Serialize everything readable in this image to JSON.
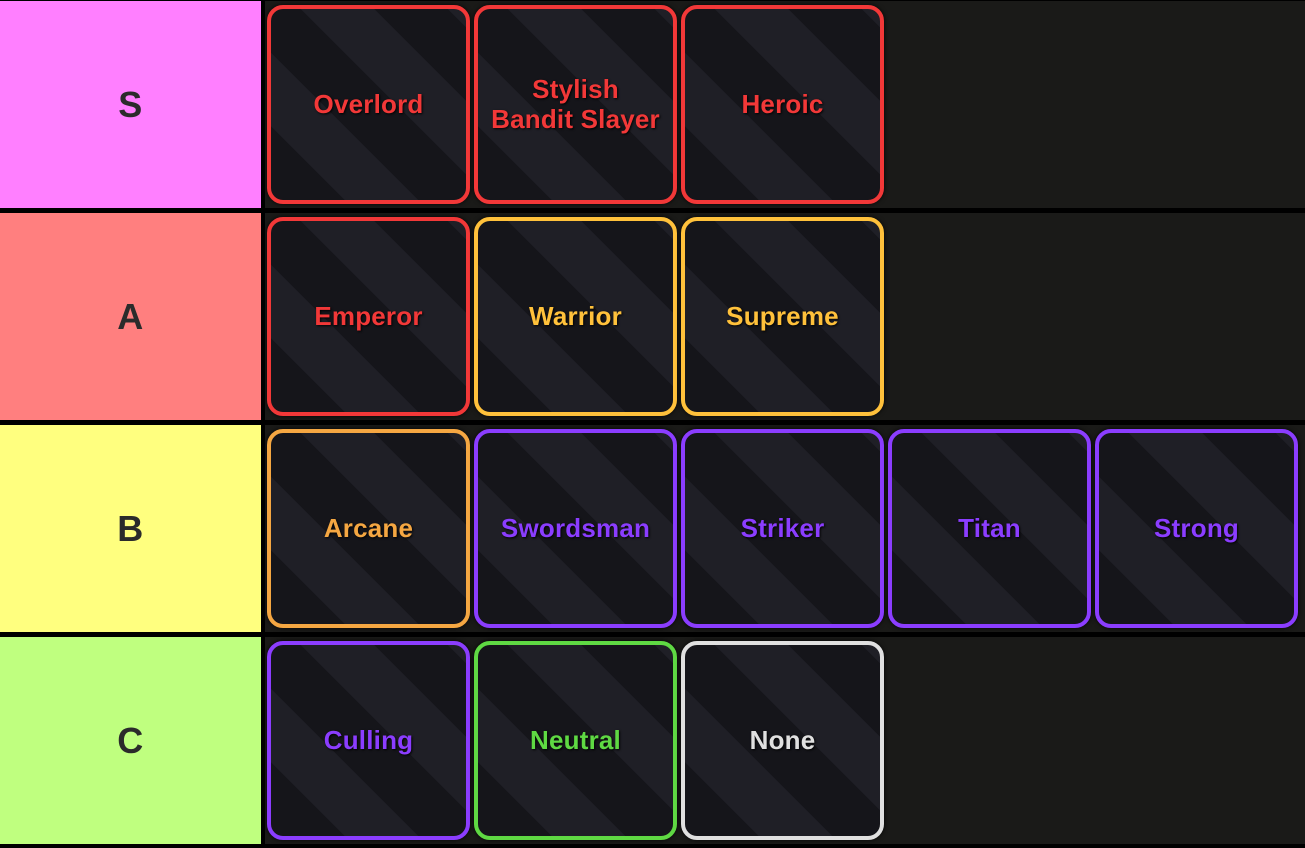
{
  "app": {
    "title": "Tier List",
    "background": "#000000",
    "row_background": "#1a1a18"
  },
  "palette": {
    "red": "#F23838",
    "gold": "#FFC13B",
    "amber": "#F5A742",
    "purple": "#8B3DFF",
    "green": "#5FD943",
    "white": "#E0E0E0",
    "tier_s": "#FF7FFF",
    "tier_a": "#FF7F7F",
    "tier_b": "#FFFF7F",
    "tier_c": "#BFFF7F",
    "tier_label_text": "#2b2b2b"
  },
  "tiers": [
    {
      "label": "S",
      "color": "#FF7FFF",
      "items": [
        {
          "label": "Overlord",
          "color": "#F23838"
        },
        {
          "label": "Stylish\nBandit Slayer",
          "color": "#F23838"
        },
        {
          "label": "Heroic",
          "color": "#F23838"
        }
      ]
    },
    {
      "label": "A",
      "color": "#FF7F7F",
      "items": [
        {
          "label": "Emperor",
          "color": "#F23838"
        },
        {
          "label": "Warrior",
          "color": "#FFC13B"
        },
        {
          "label": "Supreme",
          "color": "#FFC13B"
        }
      ]
    },
    {
      "label": "B",
      "color": "#FFFF7F",
      "items": [
        {
          "label": "Arcane",
          "color": "#F5A742"
        },
        {
          "label": "Swordsman",
          "color": "#8B3DFF"
        },
        {
          "label": "Striker",
          "color": "#8B3DFF"
        },
        {
          "label": "Titan",
          "color": "#8B3DFF"
        },
        {
          "label": "Strong",
          "color": "#8B3DFF"
        }
      ]
    },
    {
      "label": "C",
      "color": "#BFFF7F",
      "items": [
        {
          "label": "Culling",
          "color": "#8B3DFF"
        },
        {
          "label": "Neutral",
          "color": "#5FD943"
        },
        {
          "label": "None",
          "color": "#E0E0E0"
        }
      ]
    }
  ]
}
